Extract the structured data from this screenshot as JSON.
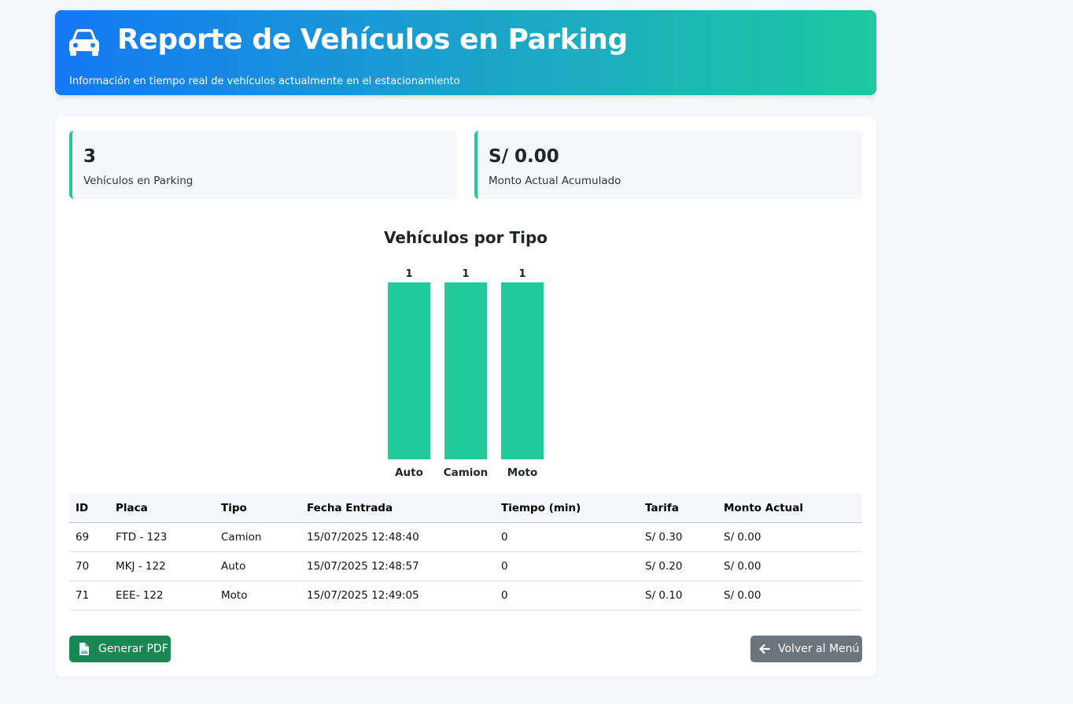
{
  "header": {
    "title": "Reporte de Vehículos en Parking",
    "subtitle": "Información en tiempo real de vehículos actualmente en el estacionamiento",
    "icon": "car-icon"
  },
  "stats": [
    {
      "value": "3",
      "label": "Vehículos en Parking"
    },
    {
      "value": "S/ 0.00",
      "label": "Monto Actual Acumulado"
    }
  ],
  "colors": {
    "accent": "#20c997",
    "bar": "#20c997",
    "header_start": "#1577f6",
    "header_end": "#1ec8a0",
    "pdf_button": "#198754",
    "back_button": "#6c757d"
  },
  "chart_data": {
    "type": "bar",
    "title": "Vehículos por Tipo",
    "categories": [
      "Auto",
      "Camion",
      "Moto"
    ],
    "values": [
      1,
      1,
      1
    ],
    "data_labels": [
      "1",
      "1",
      "1"
    ],
    "ylim": [
      0,
      1
    ],
    "grid": false
  },
  "table": {
    "columns": [
      "ID",
      "Placa",
      "Tipo",
      "Fecha Entrada",
      "Tiempo (min)",
      "Tarifa",
      "Monto Actual"
    ],
    "rows": [
      [
        "69",
        "FTD - 123",
        "Camion",
        "15/07/2025 12:48:40",
        "0",
        "S/ 0.30",
        "S/ 0.00"
      ],
      [
        "70",
        "MKJ - 122",
        "Auto",
        "15/07/2025 12:48:57",
        "0",
        "S/ 0.20",
        "S/ 0.00"
      ],
      [
        "71",
        "EEE- 122",
        "Moto",
        "15/07/2025 12:49:05",
        "0",
        "S/ 0.10",
        "S/ 0.00"
      ]
    ]
  },
  "buttons": {
    "pdf_label": "Generar PDF",
    "pdf_icon": "file-pdf-icon",
    "back_label": "Volver al Menú",
    "back_icon": "arrow-left-icon"
  }
}
